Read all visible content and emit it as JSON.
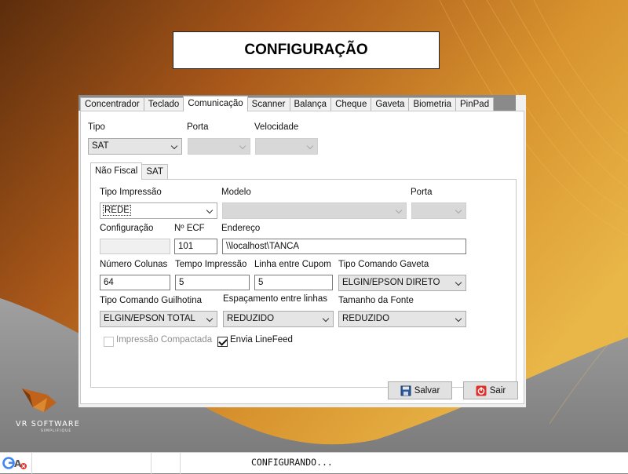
{
  "header": {
    "title": "CONFIGURAÇÃO"
  },
  "tabs": [
    {
      "label": "Concentrador"
    },
    {
      "label": "Teclado"
    },
    {
      "label": "Comunicação",
      "active": true
    },
    {
      "label": "Scanner"
    },
    {
      "label": "Balança"
    },
    {
      "label": "Cheque"
    },
    {
      "label": "Gaveta"
    },
    {
      "label": "Biometria"
    },
    {
      "label": "PinPad"
    }
  ],
  "top": {
    "tipo_label": "Tipo",
    "tipo_value": "SAT",
    "porta_label": "Porta",
    "porta_value": "",
    "velocidade_label": "Velocidade",
    "velocidade_value": ""
  },
  "subtabs": [
    {
      "label": "Não Fiscal",
      "active": true
    },
    {
      "label": "SAT"
    }
  ],
  "form": {
    "tipo_impressao_label": "Tipo Impressão",
    "tipo_impressao_value": "REDE",
    "modelo_label": "Modelo",
    "modelo_value": "",
    "porta_label": "Porta",
    "porta_value": "",
    "configuracao_label": "Configuração",
    "configuracao_value": "",
    "n_ecf_label": "Nº ECF",
    "n_ecf_value": "101",
    "endereco_label": "Endereço",
    "endereco_value": "\\\\localhost\\TANCA",
    "numero_colunas_label": "Número Colunas",
    "numero_colunas_value": "64",
    "tempo_impressao_label": "Tempo Impressão",
    "tempo_impressao_value": "5",
    "linha_cupom_label": "Linha entre Cupom",
    "linha_cupom_value": "5",
    "tipo_cmd_gaveta_label": "Tipo Comando Gaveta",
    "tipo_cmd_gaveta_value": "ELGIN/EPSON DIRETO",
    "tipo_cmd_guilhotina_label": "Tipo Comando Guilhotina",
    "tipo_cmd_guilhotina_value": "ELGIN/EPSON TOTAL",
    "espacamento_label": "Espaçamento entre linhas",
    "espacamento_value": "REDUZIDO",
    "tamanho_fonte_label": "Tamanho da Fonte",
    "tamanho_fonte_value": "REDUZIDO",
    "impressao_compactada_label": "Impressão Compactada",
    "impressao_compactada_checked": false,
    "envia_linefeed_label": "Envia LineFeed",
    "envia_linefeed_checked": true
  },
  "buttons": {
    "salvar": "Salvar",
    "sair": "Sair"
  },
  "logo": {
    "name": "VR SOFTWARE",
    "tagline": "SIMPLIFIQUE"
  },
  "status": {
    "text": "CONFIGURANDO..."
  },
  "colors": {
    "accent_orange": "#c0621a",
    "gold": "#d8a03a",
    "exit_red": "#e0302a",
    "save_blue": "#2c5a9c"
  }
}
